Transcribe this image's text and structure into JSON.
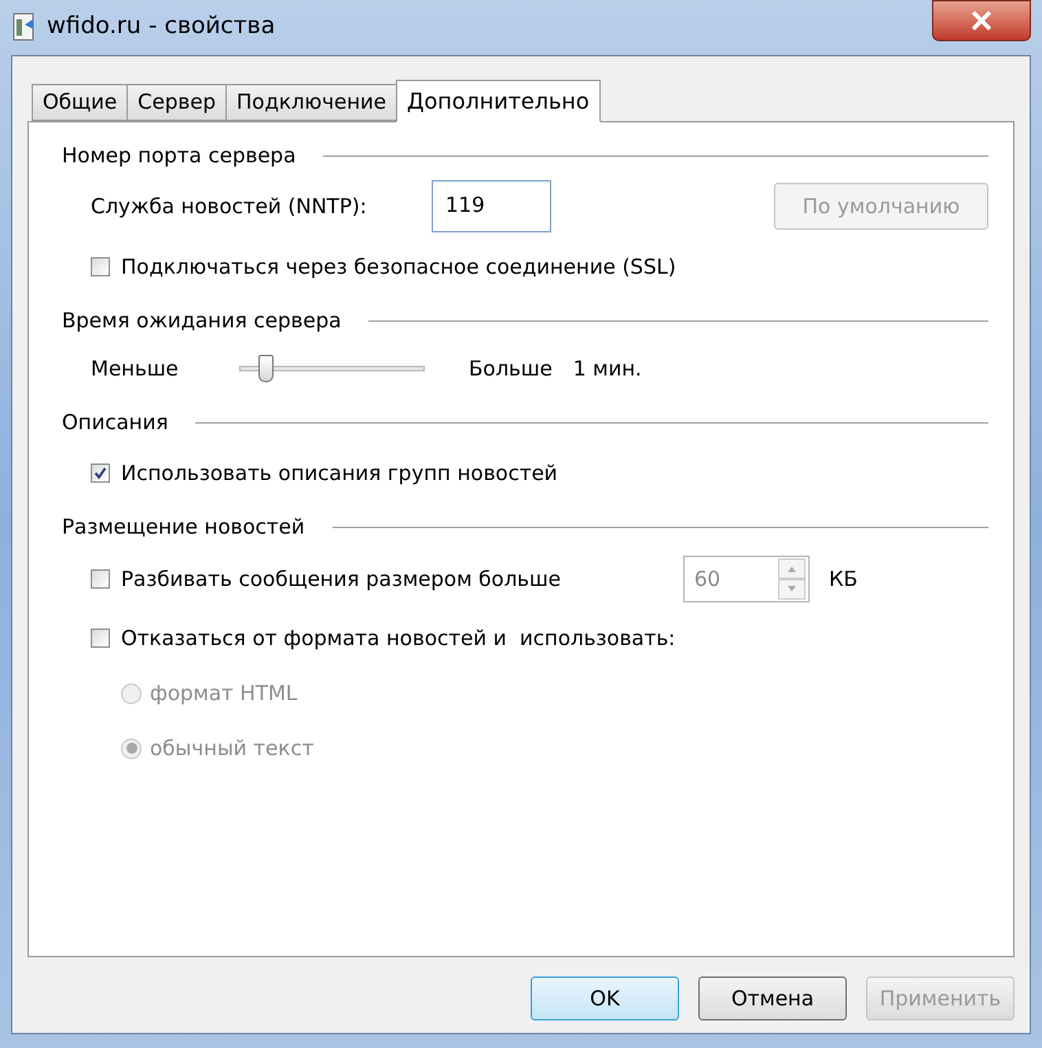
{
  "window": {
    "title": "wfido.ru - свойства"
  },
  "tabs": [
    {
      "label": "Общие",
      "selected": false
    },
    {
      "label": "Сервер",
      "selected": false
    },
    {
      "label": "Подключение",
      "selected": false
    },
    {
      "label": "Дополнительно",
      "selected": true
    }
  ],
  "sections": [
    {
      "title": "Номер порта сервера",
      "items": [
        {
          "kind": "port",
          "label": "Служба новостей (NNTP):",
          "value": "119",
          "button": {
            "label": "По умолчанию",
            "disabled": true
          }
        },
        {
          "kind": "checkbox",
          "label": "Подключаться через безопасное соединение (SSL)",
          "checked": false
        }
      ]
    },
    {
      "title": "Время ожидания сервера",
      "items": [
        {
          "kind": "slider",
          "min_label": "Меньше",
          "max_label": "Больше",
          "level": 0.13,
          "reading": "1 мин."
        }
      ]
    },
    {
      "title": "Описания",
      "items": [
        {
          "kind": "checkbox",
          "label": "Использовать описания групп новостей",
          "checked": true
        }
      ]
    },
    {
      "title": "Размещение новостей",
      "items": [
        {
          "kind": "spin",
          "label": "Разбивать сообщения размером больше",
          "checked": false,
          "value": "60",
          "disabled": true,
          "unit": "КБ"
        },
        {
          "kind": "checkbox",
          "label": "Отказаться от формата новостей и  использовать:",
          "checked": false
        },
        {
          "kind": "radio",
          "label": "формат HTML",
          "selected": false,
          "disabled": true
        },
        {
          "kind": "radio",
          "label": "обычный текст",
          "selected": true,
          "disabled": true
        }
      ]
    }
  ],
  "buttons": [
    {
      "label": "OK",
      "default": true,
      "disabled": false
    },
    {
      "label": "Отмена",
      "default": false,
      "disabled": false
    },
    {
      "label": "Применить",
      "default": false,
      "disabled": true
    }
  ]
}
